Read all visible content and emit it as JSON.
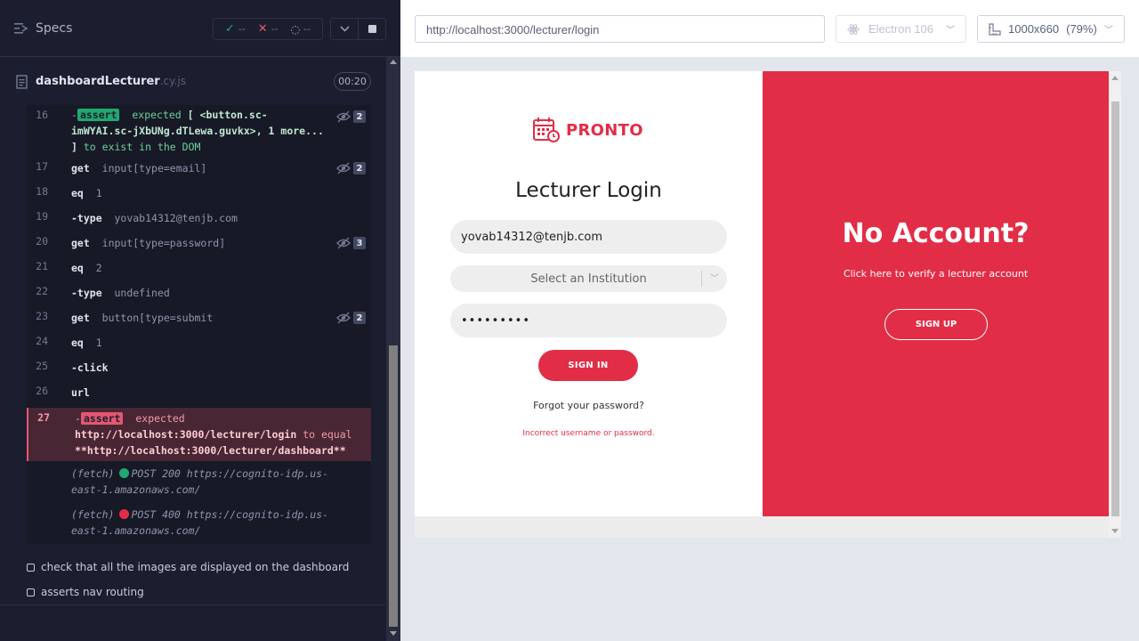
{
  "reporter": {
    "specs_label": "Specs",
    "stats": {
      "passed": "--",
      "failed": "--",
      "pending": "--"
    },
    "spec": {
      "name": "dashboardLecturer",
      "ext": ".cy.js",
      "duration": "00:20"
    },
    "commands": [
      {
        "num": "16",
        "type": "assert-pass",
        "line1_pre": "-",
        "tag": "assert",
        "line1": "expected",
        "line1_b": "[ <button.sc-",
        "line2_b": "imWYAI.sc-jXbUNg.dTLewa.guvkx>, 1 more...",
        "line3_b": "]",
        "line3": "to exist in the DOM",
        "count": "2"
      },
      {
        "num": "17",
        "name": "get",
        "arg": "input[type=email]",
        "count": "2"
      },
      {
        "num": "18",
        "name": "eq",
        "arg": "1"
      },
      {
        "num": "19",
        "name": "-type",
        "arg": "yovab14312@tenjb.com"
      },
      {
        "num": "20",
        "name": "get",
        "arg": "input[type=password]",
        "count": "3"
      },
      {
        "num": "21",
        "name": "eq",
        "arg": "2"
      },
      {
        "num": "22",
        "name": "-type",
        "arg": "undefined"
      },
      {
        "num": "23",
        "name": "get",
        "arg": "button[type=submit",
        "count": "2"
      },
      {
        "num": "24",
        "name": "eq",
        "arg": "1"
      },
      {
        "num": "25",
        "name": "-click",
        "arg": ""
      },
      {
        "num": "26",
        "name": "url",
        "arg": ""
      }
    ],
    "failed_cmd": {
      "num": "27",
      "pre": "-",
      "tag": "assert",
      "text": "expected",
      "line2_b": "http://localhost:3000/lecturer/login",
      "line2": "to equal",
      "line3_b": "**http://localhost:3000/lecturer/dashboard**"
    },
    "fetches": [
      {
        "label": "(fetch)",
        "method": "POST 200 https://cognito-idp.us-",
        "cont": "east-1.amazonaws.com/",
        "color": "#1fa971"
      },
      {
        "label": "(fetch)",
        "method": "POST 400 https://cognito-idp.us-",
        "cont": "east-1.amazonaws.com/",
        "color": "#e22d47"
      }
    ],
    "tests": [
      "check that all the images are displayed on the dashboard",
      "asserts nav routing"
    ]
  },
  "preview": {
    "url": "http://localhost:3000/lecturer/login",
    "browser": "Electron 106",
    "viewport": "1000x660",
    "zoom": "(79%)"
  },
  "app": {
    "brand": "PRONTO",
    "title": "Lecturer Login",
    "email_value": "yovab14312@tenjb.com",
    "institution_placeholder": "Select an Institution",
    "password_value": "•••••••••",
    "signin_label": "SIGN IN",
    "forgot_label": "Forgot your password?",
    "error_message": "Incorrect username or password.",
    "no_account_title": "No Account?",
    "verify_text": "Click here to verify a lecturer account",
    "signup_label": "SIGN UP",
    "accent_color": "#e22d47"
  }
}
